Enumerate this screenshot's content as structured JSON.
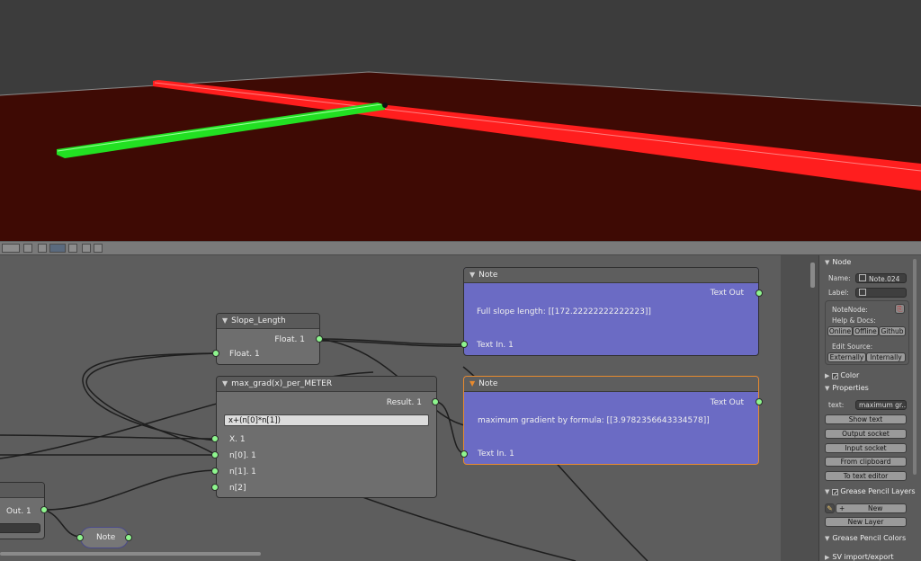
{
  "viewport": {
    "colors": {
      "sky": "#3c3c3c",
      "ground": "#3e0a04",
      "red_beam": "#ff1e1e",
      "green_beam": "#22e022"
    }
  },
  "header_icons": [
    "grid-icon",
    "view-icon",
    "shading-icon",
    "pivot-icon",
    "layers-icon",
    "render-icon"
  ],
  "nodes": {
    "note1": {
      "title": "Note",
      "text_out": "Text Out",
      "text": "Full slope length: [[172.22222222222223]]",
      "text_in": "Text In. 1"
    },
    "slope": {
      "title": "Slope_Length",
      "out": "Float. 1",
      "in": "Float. 1"
    },
    "grad": {
      "title": "max_grad(x)_per_METER",
      "result": "Result. 1",
      "formula": "x+(n[0]*n[1])",
      "inputs": [
        "X. 1",
        "n[0]. 1",
        "n[1]. 1",
        "n[2]"
      ]
    },
    "note2": {
      "title": "Note",
      "text_out": "Text Out",
      "text": "maximum gradient by formula: [[3.9782356643334578]]",
      "text_in": "Text In. 1"
    },
    "partial": {
      "out": "Out. 1"
    },
    "small_note": {
      "label": "Note"
    }
  },
  "panel": {
    "node_section": "Node",
    "name_label": "Name:",
    "name_value": "Note.024",
    "label_label": "Label:",
    "label_value": "",
    "notenode_title": "NoteNode:",
    "help_docs": "Help & Docs:",
    "help_buttons": [
      "Online",
      "Offline",
      "Github"
    ],
    "edit_source": "Edit Source:",
    "edit_buttons": [
      "Externally",
      "Internally"
    ],
    "color_section": "Color",
    "properties_section": "Properties",
    "text_label": "text:",
    "text_value": "maximum gr...",
    "prop_buttons": [
      "Show text",
      "Output socket",
      "Input socket",
      "From clipboard",
      "To text editor"
    ],
    "grease_layers": "Grease Pencil Layers",
    "new_label": "New",
    "new_layer": "New Layer",
    "grease_colors": "Grease Pencil Colors",
    "sv_import": "SV import/export"
  }
}
